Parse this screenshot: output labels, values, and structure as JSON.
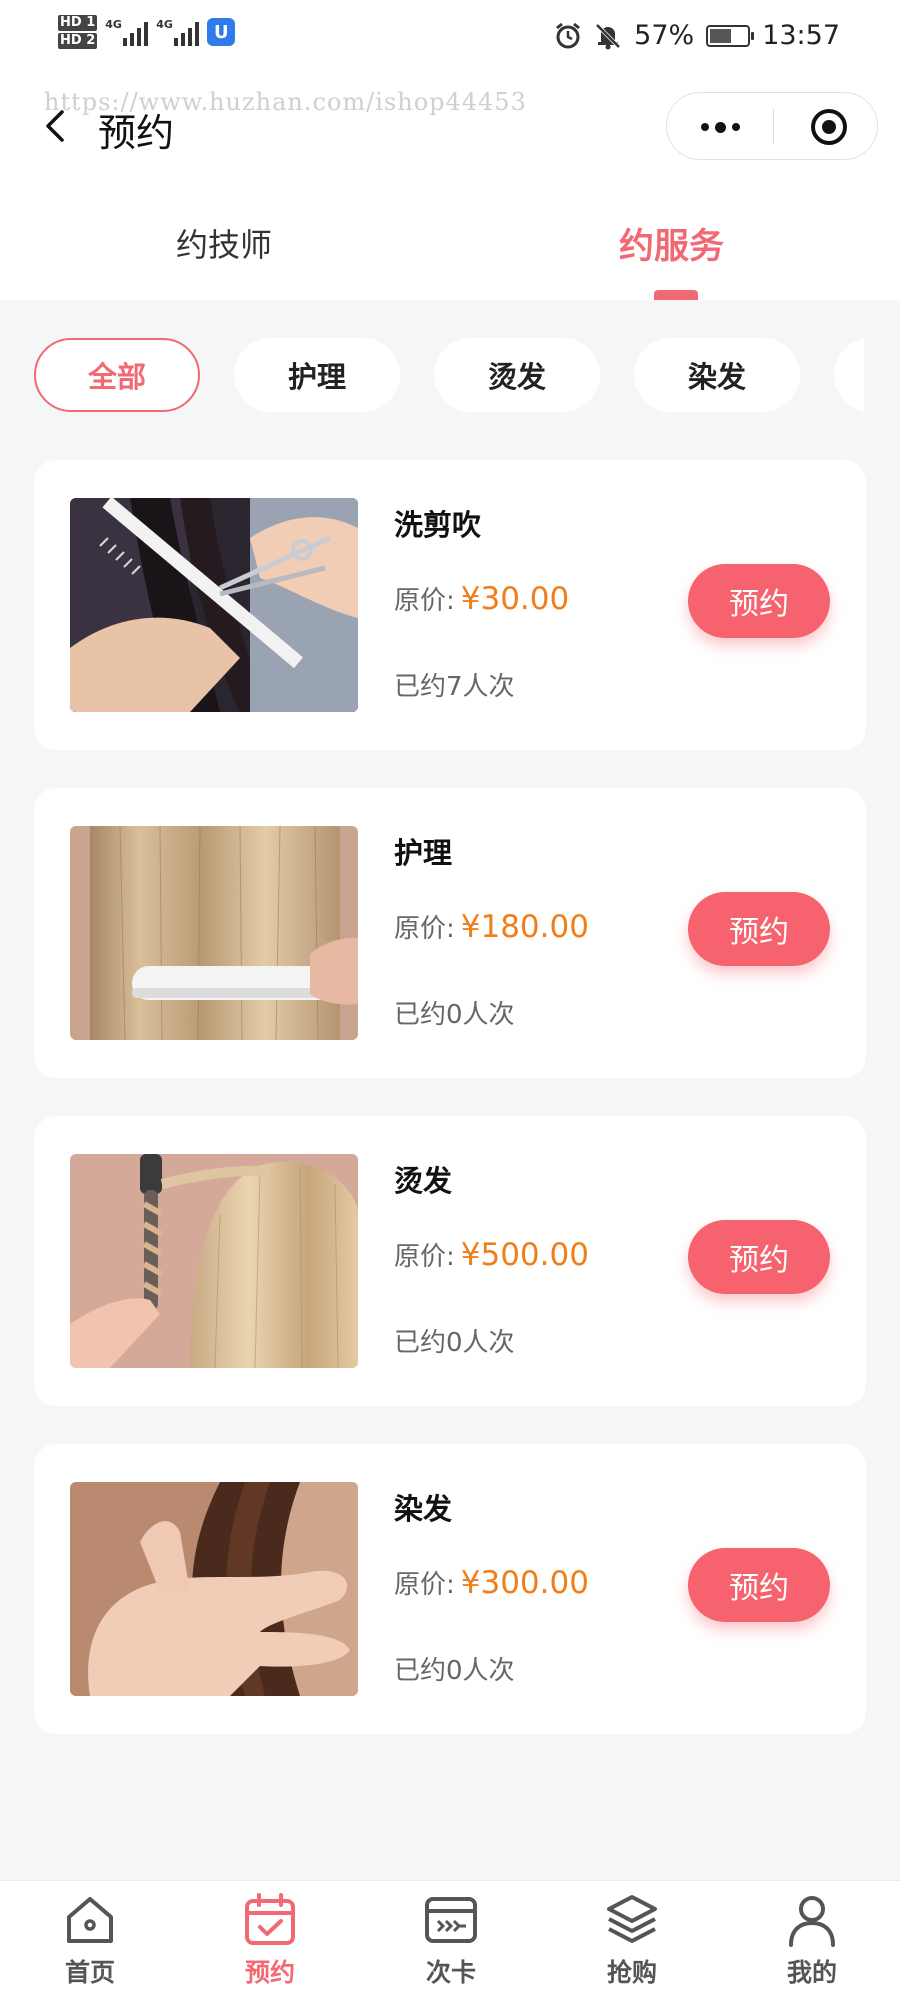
{
  "status_bar": {
    "left_badges": [
      "HD 1",
      "HD 2"
    ],
    "network_1": "4G",
    "network_2": "4G",
    "app_badge": "U",
    "battery_percent": "57%",
    "battery_level": 0.57,
    "time": "13:57",
    "icons": [
      "alarm-icon",
      "mute-icon",
      "battery-icon"
    ]
  },
  "watermark": "https://www.huzhan.com/ishop44453",
  "nav": {
    "title": "预约",
    "back_icon": "chevron-left-icon",
    "capsule_icons": [
      "more-icon",
      "target-icon"
    ]
  },
  "tabs": [
    {
      "label": "约技师",
      "active": false
    },
    {
      "label": "约服务",
      "active": true
    }
  ],
  "categories": [
    {
      "label": "全部",
      "active": true
    },
    {
      "label": "护理",
      "active": false
    },
    {
      "label": "烫发",
      "active": false
    },
    {
      "label": "染发",
      "active": false
    }
  ],
  "services": [
    {
      "name": "洗剪吹",
      "price_label": "原价:",
      "price": "¥30.00",
      "booked": "已约7人次",
      "button": "预约",
      "image": "haircut-scissors-comb"
    },
    {
      "name": "护理",
      "price_label": "原价:",
      "price": "¥180.00",
      "booked": "已约0人次",
      "button": "预约",
      "image": "hair-straightener-blonde"
    },
    {
      "name": "烫发",
      "price_label": "原价:",
      "price": "¥500.00",
      "booked": "已约0人次",
      "button": "预约",
      "image": "curling-iron-blonde"
    },
    {
      "name": "染发",
      "price_label": "原价:",
      "price": "¥300.00",
      "booked": "已约0人次",
      "button": "预约",
      "image": "brown-hair-hand"
    }
  ],
  "tabbar": [
    {
      "label": "首页",
      "icon": "home-icon",
      "active": false
    },
    {
      "label": "预约",
      "icon": "calendar-check-icon",
      "active": true
    },
    {
      "label": "次卡",
      "icon": "card-icon",
      "active": false
    },
    {
      "label": "抢购",
      "icon": "layers-icon",
      "active": false
    },
    {
      "label": "我的",
      "icon": "user-icon",
      "active": false
    }
  ],
  "colors": {
    "accent": "#f16a73",
    "button": "#f6636e",
    "price": "#ef7f1a",
    "background": "#f5f6f8"
  }
}
